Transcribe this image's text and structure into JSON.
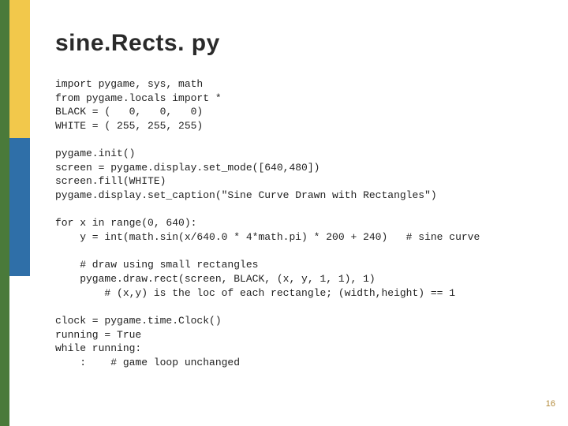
{
  "page": {
    "title": "sine.Rects. py",
    "page_number": "16"
  },
  "code": {
    "block1": "import pygame, sys, math\nfrom pygame.locals import *\nBLACK = (   0,   0,   0)\nWHITE = ( 255, 255, 255)",
    "block2": "pygame.init()\nscreen = pygame.display.set_mode([640,480])\nscreen.fill(WHITE)\npygame.display.set_caption(\"Sine Curve Drawn with Rectangles\")",
    "block3": "for x in range(0, 640):\n    y = int(math.sin(x/640.0 * 4*math.pi) * 200 + 240)   # sine curve",
    "block4": "    # draw using small rectangles\n    pygame.draw.rect(screen, BLACK, (x, y, 1, 1), 1)\n        # (x,y) is the loc of each rectangle; (width,height) == 1",
    "block5": "clock = pygame.time.Clock()\nrunning = True\nwhile running:\n    :    # game loop unchanged"
  },
  "colors": {
    "sidebar_green": "#4a7a3a",
    "sidebar_yellow": "#f2c84b",
    "sidebar_blue": "#2f6fa8"
  }
}
